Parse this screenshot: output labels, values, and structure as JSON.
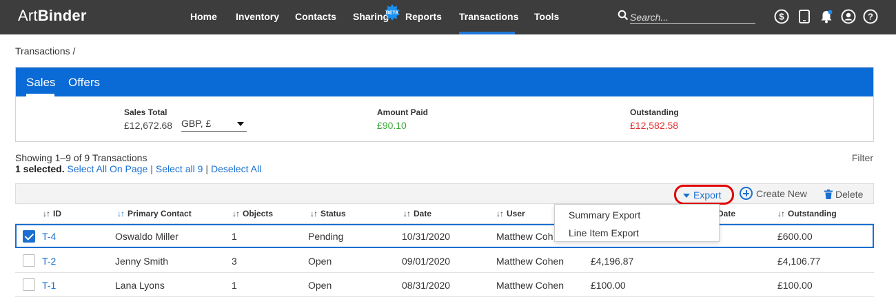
{
  "app": {
    "logo_light": "Art",
    "logo_bold": "Binder"
  },
  "nav": {
    "items": [
      "Home",
      "Inventory",
      "Contacts",
      "Sharing",
      "Reports",
      "Transactions",
      "Tools"
    ],
    "badge": "BETA",
    "active": "Transactions"
  },
  "search": {
    "placeholder": "Search..."
  },
  "top_icons": [
    "dollar-icon",
    "tablet-icon",
    "bell-icon",
    "user-icon",
    "help-icon"
  ],
  "breadcrumb": "Transactions /",
  "tabs": [
    "Sales",
    "Offers"
  ],
  "summary": {
    "sales_total_label": "Sales Total",
    "sales_total_value": "£12,672.68",
    "currency": "GBP, £",
    "amount_paid_label": "Amount Paid",
    "amount_paid_value": "£90.10",
    "outstanding_label": "Outstanding",
    "outstanding_value": "£12,582.58"
  },
  "listing": {
    "showing": "Showing 1–9 of 9 Transactions",
    "selected": "1 selected.",
    "select_all_page": "Select All On Page",
    "select_all": "Select all 9",
    "deselect_all": "Deselect All",
    "filter": "Filter"
  },
  "toolbar": {
    "export": "Export",
    "create_new": "Create New",
    "delete": "Delete"
  },
  "export_menu": [
    "Summary Export",
    "Line Item Export"
  ],
  "columns": [
    "ID",
    "Primary Contact",
    "Objects",
    "Status",
    "Date",
    "User",
    "Date",
    "Outstanding"
  ],
  "rows": [
    {
      "checked": true,
      "id": "T-4",
      "contact": "Oswaldo Miller",
      "objects": "1",
      "status": "Pending",
      "date": "10/31/2020",
      "user": "Matthew Coh",
      "amount": "",
      "outstanding": "£600.00"
    },
    {
      "checked": false,
      "id": "T-2",
      "contact": "Jenny Smith",
      "objects": "3",
      "status": "Open",
      "date": "09/01/2020",
      "user": "Matthew Cohen",
      "amount": "£4,196.87",
      "outstanding": "£4,106.77"
    },
    {
      "checked": false,
      "id": "T-1",
      "contact": "Lana Lyons",
      "objects": "1",
      "status": "Open",
      "date": "08/31/2020",
      "user": "Matthew Cohen",
      "amount": "£100.00",
      "outstanding": "£100.00"
    }
  ],
  "colors": {
    "topbar": "#3d3d3d",
    "accent": "#0a6ad6",
    "paid": "#3aa935",
    "outstanding": "#e03030",
    "highlight": "#e00000"
  }
}
